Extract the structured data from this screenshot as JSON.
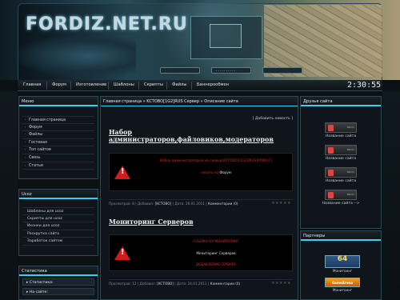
{
  "header": {
    "logo": "FORDIZ.NET.RU",
    "ticker": "· · · ·  ·  ·  ·  · · ·"
  },
  "nav": {
    "items": [
      "Главная",
      "Форум",
      "Изготовление",
      "Шаблоны",
      "Скрипты",
      "Файлы",
      "Баннерообмен"
    ],
    "clock": "2:30:55"
  },
  "menu": {
    "title": "Меню",
    "items": [
      "Главная страница",
      "Форум",
      "Файлы",
      "Гостевая",
      "Топ сайтов",
      "Связь",
      "Статьи"
    ]
  },
  "ucoz": {
    "title": "Ucoz",
    "items": [
      "Шаблоны для ucoz",
      "Скрипты для ucoz",
      "Иконки для ucoz",
      "Раскрутка сайта",
      "Заработок сайтом"
    ]
  },
  "stats": {
    "title": "Статистика",
    "rows": [
      "▸ Статистика:",
      "▸ На сайте:"
    ]
  },
  "center": {
    "breadcrumb": "Главная страница » KCTOBO[1G2]RUS Сервер » Описание сайта",
    "add_news": "[ Добавить новость ]",
    "articles": [
      {
        "title": "Набор администраторов,файловиков,модераторов",
        "line1": "Набор администраторов на сервер[KCTOBO][1G2][RUS][PUBLIC]",
        "line2_red": "писать на",
        "line2_white": "Форум",
        "meta_views": "Просмотров: 8",
        "meta_author_label": "Добавил:",
        "meta_author": "[KCTOBO]",
        "meta_date": "Дата: 26.01.2011",
        "meta_comments": "Комментарии (0)",
        "stars": "★★★★★"
      },
      {
        "title": "Мониторинг Серверов",
        "line1": "ССЫЛКА НА МОНИТОРИНГ",
        "line2_white": "Мониторинг Серверов",
        "line3": "ДОБАВЛЕНИЕ СЕРВЕРА",
        "meta_views": "Просмотров: 12",
        "meta_author_label": "Добавил:",
        "meta_author": "[KCTOBO]",
        "meta_date": "Дата: 24.01.2011",
        "meta_comments": "Комментарии (0)",
        "stars": "★★★★★"
      }
    ]
  },
  "friends": {
    "title": "Друзья сайта",
    "items": [
      "Название сайта",
      "Название сайта",
      "Название сайта",
      "Название сайта -->"
    ]
  },
  "partners": {
    "title": "Партнеры",
    "items": [
      {
        "badge": "64",
        "label": "Монитоинг"
      },
      {
        "badge": "GameArena",
        "label": "Монитоинг"
      }
    ]
  },
  "colors": {
    "accent": "#3ad0f0",
    "warning": "#d01c1c"
  }
}
